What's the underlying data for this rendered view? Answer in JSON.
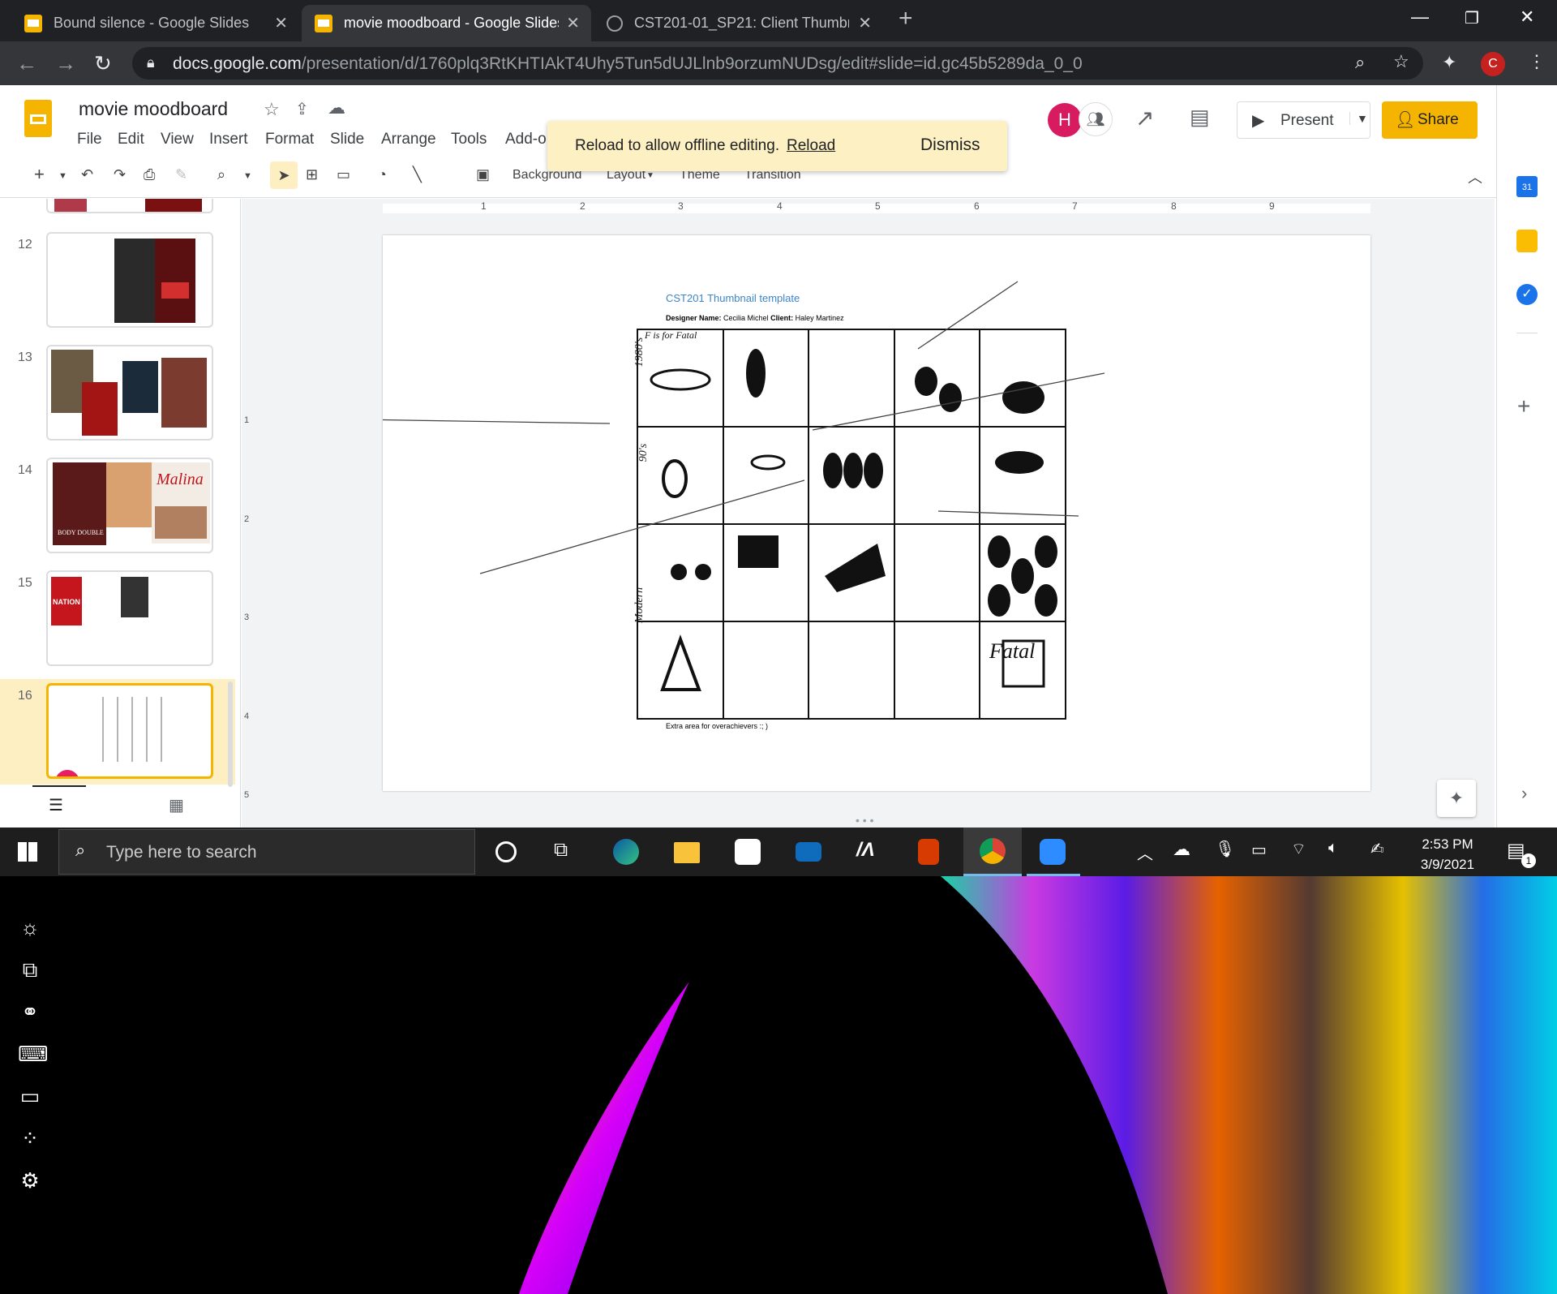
{
  "browser": {
    "tabs": [
      {
        "title": "Bound silence - Google Slides",
        "active": false
      },
      {
        "title": "movie moodboard - Google Slides",
        "active": true
      },
      {
        "title": "CST201-01_SP21: Client Thumbnails",
        "active": false
      }
    ],
    "url_domain": "docs.google.com",
    "url_path": "/presentation/d/1760plq3RtKHTIAkT4Uhy5Tun5dUJLlnb9orzumNUDsg/edit#slide=id.gc45b5289da_0_0",
    "profile_initial": "C"
  },
  "doc": {
    "title": "movie moodboard",
    "menus": [
      "File",
      "Edit",
      "View",
      "Insert",
      "Format",
      "Slide",
      "Arrange",
      "Tools",
      "Add-or"
    ],
    "present_label": "Present",
    "share_label": "Share",
    "collab_initial": "H",
    "user_initial": "C"
  },
  "toast": {
    "message": "Reload to allow offline editing.",
    "reload_label": "Reload",
    "dismiss_label": "Dismiss"
  },
  "toolbar": {
    "background_label": "Background",
    "layout_label": "Layout",
    "theme_label": "Theme",
    "transition_label": "Transition"
  },
  "ruler": {
    "ticks": [
      "1",
      "2",
      "3",
      "4",
      "5",
      "6",
      "7",
      "8",
      "9"
    ],
    "vticks": [
      "1",
      "2",
      "3",
      "4",
      "5"
    ]
  },
  "filmstrip": {
    "slides": [
      "12",
      "13",
      "14",
      "15",
      "16"
    ],
    "poster_text": {
      "nation": "NATION",
      "malena": "Malina",
      "body_double": "BODY DOUBLE"
    }
  },
  "slide": {
    "template_title": "CST201 Thumbnail template",
    "designer_label": "Designer Name:",
    "designer_name": "Cecilia Michel",
    "client_label": "Client:",
    "client_name": "Haley Martinez",
    "row_labels": [
      "1980's",
      "90's",
      "",
      "Modern"
    ],
    "footer": "Extra area for overachievers :; )",
    "sketch_text": "F is for Fatal",
    "fatal_text": "Fatal"
  },
  "taskbar": {
    "search_placeholder": "Type here to search",
    "time": "2:53 PM",
    "date": "3/9/2021",
    "notification_count": "1"
  },
  "colors": {
    "slides_yellow": "#f4b400",
    "chrome_dark": "#202124",
    "toast_bg": "#fdf0c3",
    "avatar_h": "#d81b60",
    "avatar_c": "#c5221f"
  },
  "icons": [
    "slides-logo-icon",
    "star-icon",
    "move-icon",
    "cloud-icon",
    "trend-icon",
    "comment-icon",
    "undo-icon",
    "redo-icon",
    "print-icon",
    "zoom-icon",
    "cursor-icon",
    "textbox-icon",
    "image-icon",
    "shape-icon",
    "line-icon",
    "calendar-icon",
    "keep-icon",
    "tasks-icon",
    "windows-icon",
    "search-icon",
    "cortana-icon",
    "taskview-icon",
    "edge-icon",
    "explorer-icon",
    "store-icon",
    "mail-icon",
    "chrome-icon",
    "zoom-app-icon",
    "office-icon",
    "brightness-icon",
    "settings-icon"
  ]
}
